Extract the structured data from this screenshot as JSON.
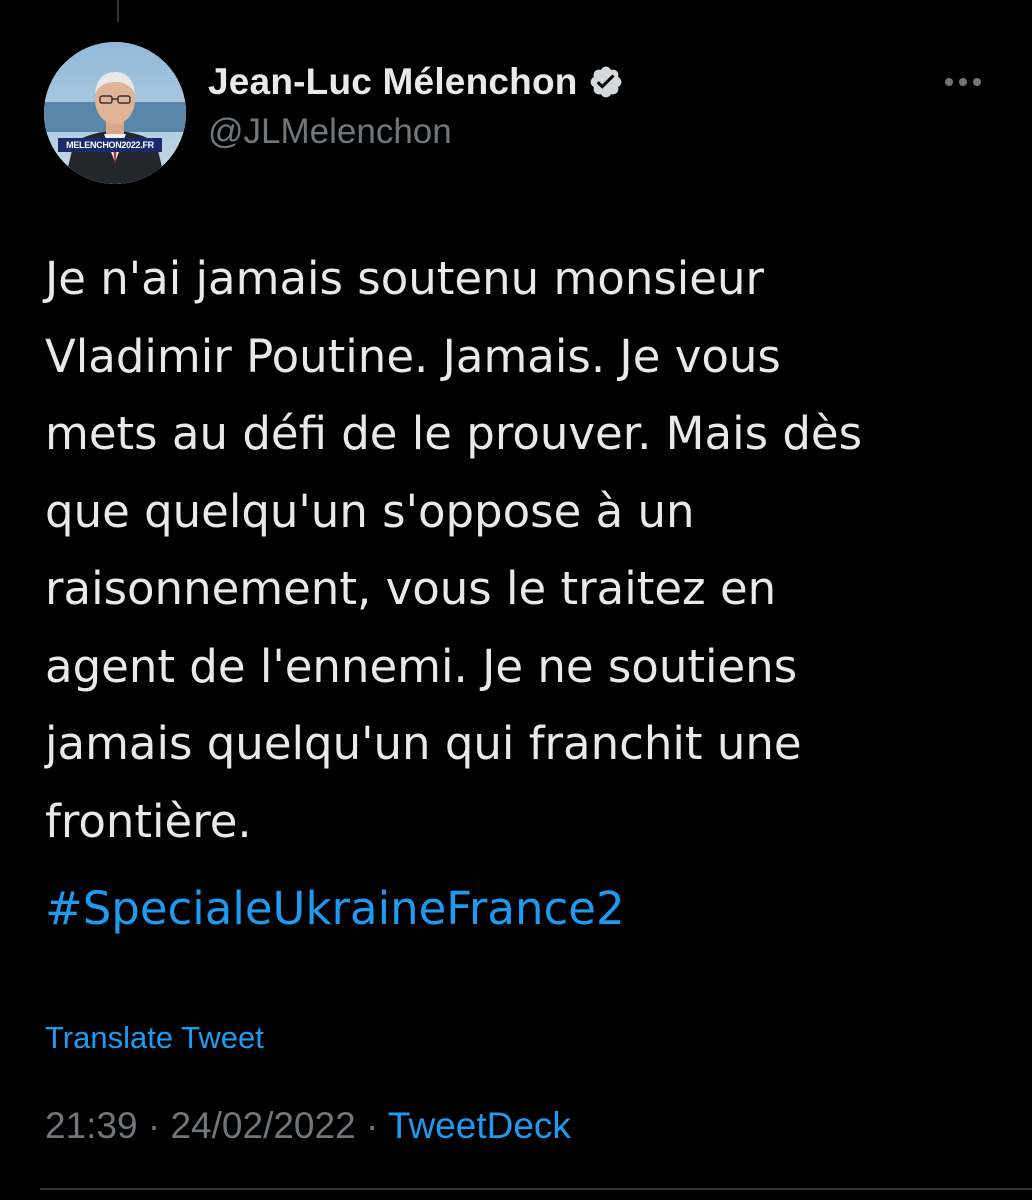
{
  "tweet": {
    "author": {
      "display_name": "Jean-Luc Mélenchon",
      "handle": "@JLMelenchon",
      "avatar_banner": "MELENCHON2022.FR",
      "verified_icon": "verified-badge-icon"
    },
    "text_lines": [
      "Je n'ai jamais soutenu monsieur",
      "Vladimir Poutine. Jamais. Je vous",
      "mets au défi de le prouver. Mais dès",
      "que quelqu'un s'oppose à un",
      "raisonnement, vous le traitez en",
      "agent de l'ennemi. Je ne soutiens",
      "jamais quelqu'un qui franchit une",
      "frontière."
    ],
    "hashtag": "#SpecialeUkraineFrance2",
    "translate_label": "Translate Tweet",
    "time": "21:39",
    "separator": " · ",
    "date": "24/02/2022",
    "source": "TweetDeck"
  },
  "icons": {
    "more": "more-dots-icon"
  },
  "colors": {
    "background": "#000000",
    "text": "#e7e9ea",
    "secondary": "#71767b",
    "accent": "#1d9bf0"
  }
}
